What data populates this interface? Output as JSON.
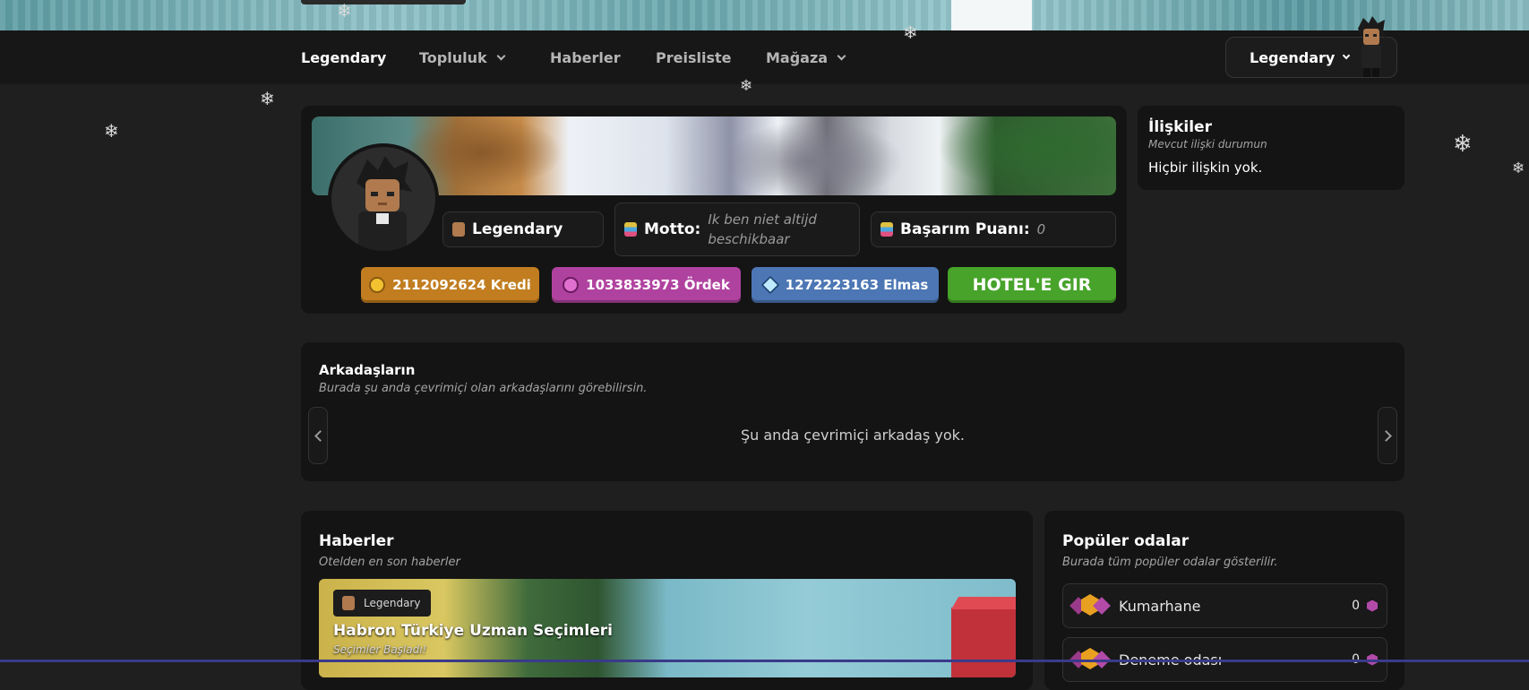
{
  "nav": {
    "brand": "Legendary",
    "items": [
      {
        "label": "Topluluk",
        "dropdown": true
      },
      {
        "label": "Haberler",
        "dropdown": false
      },
      {
        "label": "Preisliste",
        "dropdown": false
      },
      {
        "label": "Mağaza",
        "dropdown": true
      }
    ],
    "user_label": "Legendary"
  },
  "profile": {
    "username": "Legendary",
    "motto_label": "Motto:",
    "motto_value": "Ik ben niet altijd beschikbaar",
    "achievement_label": "Başarım Puanı:",
    "achievement_value": "0",
    "currencies": [
      {
        "text": "2112092624 Kredi",
        "color": "#c17d1f",
        "icon": "coin-icon"
      },
      {
        "text": "1033833973 Ördek",
        "color": "#b0429f",
        "icon": "duck-icon"
      },
      {
        "text": "1272223163 Elmas",
        "color": "#4c76b4",
        "icon": "diamond-icon"
      }
    ],
    "hotel_button": "HOTEL'E GIR",
    "hotel_button_color": "#47a32a"
  },
  "relations": {
    "title": "İlişkiler",
    "subtitle": "Mevcut ilişki durumun",
    "empty_text": "Hiçbir ilişkin yok."
  },
  "friends": {
    "title": "Arkadaşların",
    "subtitle": "Burada şu anda çevrimiçi olan arkadaşlarını görebilirsin.",
    "empty_text": "Şu anda çevrimiçi arkadaş yok."
  },
  "news": {
    "title": "Haberler",
    "subtitle": "Otelden en son haberler",
    "article": {
      "author": "Legendary",
      "title": "Habron Türkiye Uzman Seçimleri",
      "subtitle": "Seçimler Başladı!"
    }
  },
  "rooms": {
    "title": "Popüler odalar",
    "subtitle": "Burada tüm popüler odalar gösterilir.",
    "items": [
      {
        "name": "Kumarhane",
        "count": "0"
      },
      {
        "name": "Deneme odası",
        "count": "0"
      }
    ]
  }
}
